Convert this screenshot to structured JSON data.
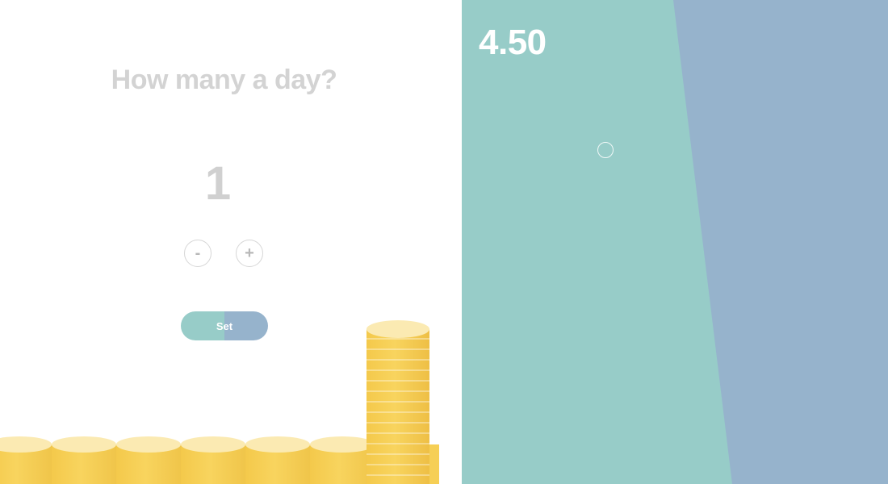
{
  "question": "How many a day?",
  "count": "1",
  "buttons": {
    "decrement_label": "-",
    "increment_label": "+",
    "set_label": "Set"
  },
  "display": {
    "amount": "4.50"
  },
  "colors": {
    "teal": "#97ccc8",
    "blue": "#96b3cc",
    "coin_gold": "#f8d45e",
    "coin_top": "#fbeab2",
    "muted_text": "#d3d3d3"
  },
  "icons": {
    "handle": "circle-outline"
  }
}
